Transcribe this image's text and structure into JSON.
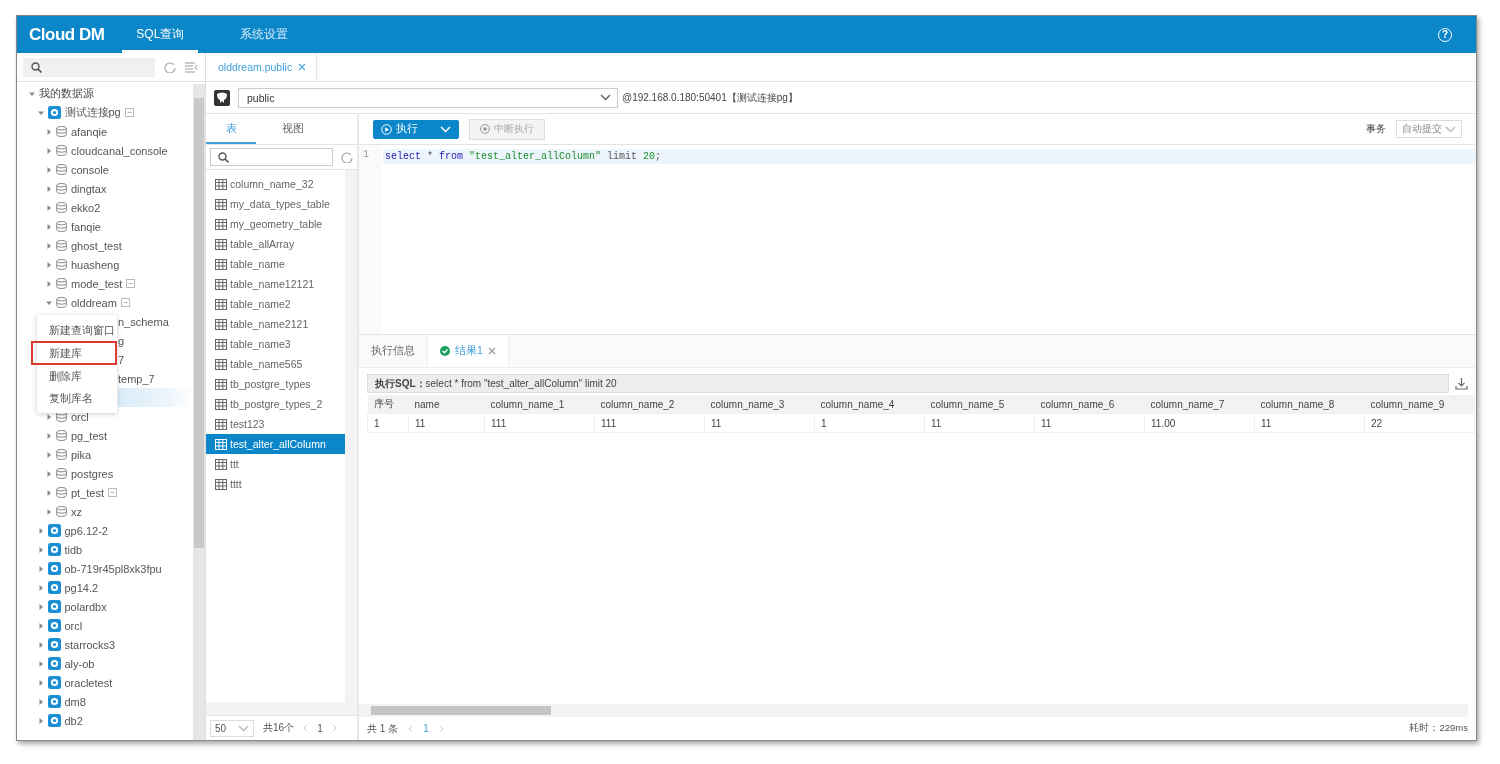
{
  "header": {
    "logo": "Cloud DM",
    "tabs": [
      {
        "label": "SQL查询",
        "selected": true
      },
      {
        "label": "系统设置",
        "selected": false
      }
    ],
    "help": "?"
  },
  "sidebar": {
    "tree": [
      {
        "label": "我的数据源",
        "kind": "group",
        "expanded": true,
        "selected": false,
        "children": [
          {
            "label": "测试连接pg",
            "kind": "connection",
            "expanded": true,
            "badge": true,
            "selected": false,
            "children": [
              {
                "label": "afanqie",
                "kind": "database",
                "expanded": false,
                "selected": false
              },
              {
                "label": "cloudcanal_console",
                "kind": "database",
                "expanded": false,
                "selected": false
              },
              {
                "label": "console",
                "kind": "database",
                "expanded": false,
                "selected": false
              },
              {
                "label": "dingtax",
                "kind": "database",
                "expanded": false,
                "selected": false
              },
              {
                "label": "ekko2",
                "kind": "database",
                "expanded": false,
                "selected": false
              },
              {
                "label": "fanqie",
                "kind": "database",
                "expanded": false,
                "selected": false
              },
              {
                "label": "ghost_test",
                "kind": "database",
                "expanded": false,
                "selected": false
              },
              {
                "label": "huasheng",
                "kind": "database",
                "expanded": false,
                "selected": false
              },
              {
                "label": "mode_test",
                "kind": "database",
                "expanded": false,
                "badge": true,
                "selected": false
              },
              {
                "label": "olddream",
                "kind": "database",
                "expanded": true,
                "badge": true,
                "selected": false,
                "children": [
                  {
                    "label": "n_schema",
                    "kind": "partial",
                    "selected": false
                  },
                  {
                    "label": "g",
                    "kind": "partial",
                    "selected": false
                  },
                  {
                    "label": "7",
                    "kind": "partial",
                    "selected": false
                  },
                  {
                    "label": "temp_7",
                    "kind": "partial",
                    "selected": false
                  },
                  {
                    "kind": "partial",
                    "selected": true
                  }
                ]
              },
              {
                "label": "orcl",
                "kind": "database",
                "expanded": false,
                "selected": false
              },
              {
                "label": "pg_test",
                "kind": "database",
                "expanded": false,
                "selected": false
              },
              {
                "label": "pika",
                "kind": "database",
                "expanded": false,
                "selected": false
              },
              {
                "label": "postgres",
                "kind": "database",
                "expanded": false,
                "selected": false
              },
              {
                "label": "pt_test",
                "kind": "database",
                "expanded": false,
                "badge": true,
                "selected": false
              },
              {
                "label": "xz",
                "kind": "database",
                "expanded": false,
                "selected": false
              }
            ]
          },
          {
            "label": "gp6.12-2",
            "kind": "connection",
            "expanded": false,
            "selected": false
          },
          {
            "label": "tidb",
            "kind": "connection",
            "expanded": false,
            "selected": false
          },
          {
            "label": "ob-719r45pl8xk3fpu",
            "kind": "connection",
            "expanded": false,
            "selected": false
          },
          {
            "label": "pg14.2",
            "kind": "connection",
            "expanded": false,
            "selected": false
          },
          {
            "label": "polardbx",
            "kind": "connection",
            "expanded": false,
            "selected": false
          },
          {
            "label": "orcl",
            "kind": "connection",
            "expanded": false,
            "selected": false
          },
          {
            "label": "starrocks3",
            "kind": "connection",
            "expanded": false,
            "selected": false
          },
          {
            "label": "aly-ob",
            "kind": "connection",
            "expanded": false,
            "selected": false
          },
          {
            "label": "oracletest",
            "kind": "connection",
            "expanded": false,
            "selected": false
          },
          {
            "label": "dm8",
            "kind": "connection",
            "expanded": false,
            "selected": false
          },
          {
            "label": "db2",
            "kind": "connection",
            "expanded": false,
            "selected": false
          }
        ]
      }
    ]
  },
  "context_menu": {
    "items": [
      {
        "label": "新建查询窗口",
        "highlighted": false
      },
      {
        "label": "新建库",
        "highlighted": true
      },
      {
        "label": "删除库",
        "highlighted": false
      },
      {
        "label": "复制库名",
        "highlighted": false
      }
    ]
  },
  "editor_tabs": [
    {
      "label": "olddream.public",
      "selected": true
    }
  ],
  "schema_bar": {
    "schema": "public",
    "connection": "@192.168.0.180:50401【测试连接pg】"
  },
  "object_panel": {
    "tabs": [
      {
        "label": "表",
        "selected": true
      },
      {
        "label": "视图",
        "selected": false
      }
    ],
    "items": [
      {
        "label": "column_name_32",
        "selected": false
      },
      {
        "label": "my_data_types_table",
        "selected": false
      },
      {
        "label": "my_geometry_table",
        "selected": false
      },
      {
        "label": "table_allArray",
        "selected": false
      },
      {
        "label": "table_name",
        "selected": false
      },
      {
        "label": "table_name12121",
        "selected": false
      },
      {
        "label": "table_name2",
        "selected": false
      },
      {
        "label": "table_name2121",
        "selected": false
      },
      {
        "label": "table_name3",
        "selected": false
      },
      {
        "label": "table_name565",
        "selected": false
      },
      {
        "label": "tb_postgre_types",
        "selected": false
      },
      {
        "label": "tb_postgre_types_2",
        "selected": false
      },
      {
        "label": "test123",
        "selected": false
      },
      {
        "label": "test_alter_allColumn",
        "selected": true
      },
      {
        "label": "ttt",
        "selected": false
      },
      {
        "label": "tttt",
        "selected": false
      }
    ],
    "pagination": {
      "page_size": "50",
      "total": "共16个",
      "page": "1"
    }
  },
  "toolbar": {
    "run": "执行",
    "stop": {
      "label": "中断执行",
      "disabled": true
    },
    "transaction_label": "事务",
    "transaction_mode": "自动提交"
  },
  "editor": {
    "lines": [
      {
        "number": "1",
        "tokens": [
          {
            "text": "select",
            "kind": "keyword"
          },
          {
            "text": " * ",
            "kind": "plain"
          },
          {
            "text": "from",
            "kind": "keyword"
          },
          {
            "text": " \"test_alter_allColumn\"",
            "kind": "string"
          },
          {
            "text": " limit ",
            "kind": "plain"
          },
          {
            "text": "20",
            "kind": "number"
          },
          {
            "text": ";",
            "kind": "plain"
          }
        ]
      }
    ]
  },
  "results": {
    "tabs": [
      {
        "label": "执行信息",
        "kind": "info",
        "selected": false
      },
      {
        "label": "结果1",
        "kind": "result",
        "selected": true
      }
    ],
    "sql": "**执行SQL：**select * from \"test_alter_allColumn\" limit 20",
    "columns": [
      "序号",
      "name",
      "column_name_1",
      "column_name_2",
      "column_name_3",
      "column_name_4",
      "column_name_5",
      "column_name_6",
      "column_name_7",
      "column_name_8",
      "column_name_9"
    ],
    "rows": [
      [
        "1",
        "11",
        "111",
        "111",
        "11",
        "1",
        "11",
        "11",
        "11.00",
        "11",
        "22"
      ]
    ],
    "footer": {
      "total": "共 1 条",
      "page": "1",
      "elapsed": "耗时：229ms"
    }
  }
}
